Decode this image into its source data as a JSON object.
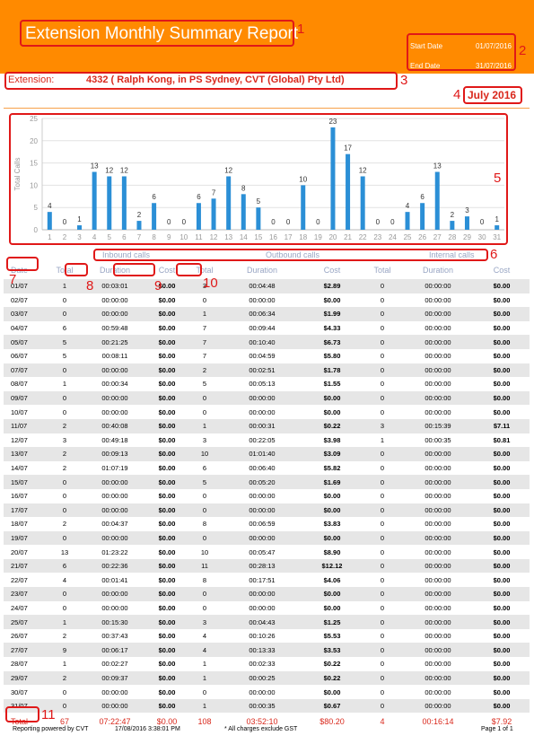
{
  "report": {
    "title": "Extension Monthly Summary Report",
    "start_date_label": "Start Date",
    "start_date": "01/07/2016",
    "end_date_label": "End Date",
    "end_date": "31/07/2016",
    "extension_label": "Extension:",
    "extension_value": "4332 ( Ralph Kong,  in PS Sydney,  CVT (Global) Pty Ltd)",
    "month": "July 2016"
  },
  "annotations": [
    "1",
    "2",
    "3",
    "4",
    "5",
    "6",
    "7",
    "8",
    "9",
    "10",
    "11"
  ],
  "legend": {
    "inbound": "Inbound calls",
    "outbound": "Outbound calls",
    "internal": "Internal calls"
  },
  "table": {
    "headers": [
      "Date",
      "Total",
      "Duration",
      "Cost",
      "Total",
      "Duration",
      "Cost",
      "Total",
      "Duration",
      "Cost"
    ],
    "rows": [
      [
        "01/07",
        "1",
        "00:03:01",
        "$0.00",
        "3",
        "00:04:48",
        "$2.89",
        "0",
        "00:00:00",
        "$0.00"
      ],
      [
        "02/07",
        "0",
        "00:00:00",
        "$0.00",
        "0",
        "00:00:00",
        "$0.00",
        "0",
        "00:00:00",
        "$0.00"
      ],
      [
        "03/07",
        "0",
        "00:00:00",
        "$0.00",
        "1",
        "00:06:34",
        "$1.99",
        "0",
        "00:00:00",
        "$0.00"
      ],
      [
        "04/07",
        "6",
        "00:59:48",
        "$0.00",
        "7",
        "00:09:44",
        "$4.33",
        "0",
        "00:00:00",
        "$0.00"
      ],
      [
        "05/07",
        "5",
        "00:21:25",
        "$0.00",
        "7",
        "00:10:40",
        "$6.73",
        "0",
        "00:00:00",
        "$0.00"
      ],
      [
        "06/07",
        "5",
        "00:08:11",
        "$0.00",
        "7",
        "00:04:59",
        "$5.80",
        "0",
        "00:00:00",
        "$0.00"
      ],
      [
        "07/07",
        "0",
        "00:00:00",
        "$0.00",
        "2",
        "00:02:51",
        "$1.78",
        "0",
        "00:00:00",
        "$0.00"
      ],
      [
        "08/07",
        "1",
        "00:00:34",
        "$0.00",
        "5",
        "00:05:13",
        "$1.55",
        "0",
        "00:00:00",
        "$0.00"
      ],
      [
        "09/07",
        "0",
        "00:00:00",
        "$0.00",
        "0",
        "00:00:00",
        "$0.00",
        "0",
        "00:00:00",
        "$0.00"
      ],
      [
        "10/07",
        "0",
        "00:00:00",
        "$0.00",
        "0",
        "00:00:00",
        "$0.00",
        "0",
        "00:00:00",
        "$0.00"
      ],
      [
        "11/07",
        "2",
        "00:40:08",
        "$0.00",
        "1",
        "00:00:31",
        "$0.22",
        "3",
        "00:15:39",
        "$7.11"
      ],
      [
        "12/07",
        "3",
        "00:49:18",
        "$0.00",
        "3",
        "00:22:05",
        "$3.98",
        "1",
        "00:00:35",
        "$0.81"
      ],
      [
        "13/07",
        "2",
        "00:09:13",
        "$0.00",
        "10",
        "01:01:40",
        "$3.09",
        "0",
        "00:00:00",
        "$0.00"
      ],
      [
        "14/07",
        "2",
        "01:07:19",
        "$0.00",
        "6",
        "00:06:40",
        "$5.82",
        "0",
        "00:00:00",
        "$0.00"
      ],
      [
        "15/07",
        "0",
        "00:00:00",
        "$0.00",
        "5",
        "00:05:20",
        "$1.69",
        "0",
        "00:00:00",
        "$0.00"
      ],
      [
        "16/07",
        "0",
        "00:00:00",
        "$0.00",
        "0",
        "00:00:00",
        "$0.00",
        "0",
        "00:00:00",
        "$0.00"
      ],
      [
        "17/07",
        "0",
        "00:00:00",
        "$0.00",
        "0",
        "00:00:00",
        "$0.00",
        "0",
        "00:00:00",
        "$0.00"
      ],
      [
        "18/07",
        "2",
        "00:04:37",
        "$0.00",
        "8",
        "00:06:59",
        "$3.83",
        "0",
        "00:00:00",
        "$0.00"
      ],
      [
        "19/07",
        "0",
        "00:00:00",
        "$0.00",
        "0",
        "00:00:00",
        "$0.00",
        "0",
        "00:00:00",
        "$0.00"
      ],
      [
        "20/07",
        "13",
        "01:23:22",
        "$0.00",
        "10",
        "00:05:47",
        "$8.90",
        "0",
        "00:00:00",
        "$0.00"
      ],
      [
        "21/07",
        "6",
        "00:22:36",
        "$0.00",
        "11",
        "00:28:13",
        "$12.12",
        "0",
        "00:00:00",
        "$0.00"
      ],
      [
        "22/07",
        "4",
        "00:01:41",
        "$0.00",
        "8",
        "00:17:51",
        "$4.06",
        "0",
        "00:00:00",
        "$0.00"
      ],
      [
        "23/07",
        "0",
        "00:00:00",
        "$0.00",
        "0",
        "00:00:00",
        "$0.00",
        "0",
        "00:00:00",
        "$0.00"
      ],
      [
        "24/07",
        "0",
        "00:00:00",
        "$0.00",
        "0",
        "00:00:00",
        "$0.00",
        "0",
        "00:00:00",
        "$0.00"
      ],
      [
        "25/07",
        "1",
        "00:15:30",
        "$0.00",
        "3",
        "00:04:43",
        "$1.25",
        "0",
        "00:00:00",
        "$0.00"
      ],
      [
        "26/07",
        "2",
        "00:37:43",
        "$0.00",
        "4",
        "00:10:26",
        "$5.53",
        "0",
        "00:00:00",
        "$0.00"
      ],
      [
        "27/07",
        "9",
        "00:06:17",
        "$0.00",
        "4",
        "00:13:33",
        "$3.53",
        "0",
        "00:00:00",
        "$0.00"
      ],
      [
        "28/07",
        "1",
        "00:02:27",
        "$0.00",
        "1",
        "00:02:33",
        "$0.22",
        "0",
        "00:00:00",
        "$0.00"
      ],
      [
        "29/07",
        "2",
        "00:09:37",
        "$0.00",
        "1",
        "00:00:25",
        "$0.22",
        "0",
        "00:00:00",
        "$0.00"
      ],
      [
        "30/07",
        "0",
        "00:00:00",
        "$0.00",
        "0",
        "00:00:00",
        "$0.00",
        "0",
        "00:00:00",
        "$0.00"
      ],
      [
        "31/07",
        "0",
        "00:00:00",
        "$0.00",
        "1",
        "00:00:35",
        "$0.67",
        "0",
        "00:00:00",
        "$0.00"
      ]
    ],
    "totals": [
      "Total",
      "67",
      "07:22:47",
      "$0.00",
      "108",
      "03:52:10",
      "$80.20",
      "4",
      "00:16:14",
      "$7.92"
    ]
  },
  "footer": {
    "powered_by": "Reporting powered by CVT",
    "generated": "17/08/2016 3:38:01 PM",
    "note": "* All charges exclude GST",
    "page": "Page 1 of 1"
  },
  "chart_data": {
    "type": "bar",
    "ylabel": "Total Calls",
    "ylim": [
      0,
      25
    ],
    "yticks": [
      0,
      5,
      10,
      15,
      20,
      25
    ],
    "categories": [
      "1",
      "2",
      "3",
      "4",
      "5",
      "6",
      "7",
      "8",
      "9",
      "10",
      "11",
      "12",
      "13",
      "14",
      "15",
      "16",
      "17",
      "18",
      "19",
      "20",
      "21",
      "22",
      "23",
      "24",
      "25",
      "26",
      "27",
      "28",
      "29",
      "30",
      "31"
    ],
    "values": [
      4,
      0,
      1,
      13,
      12,
      12,
      2,
      6,
      0,
      0,
      6,
      7,
      12,
      8,
      5,
      0,
      0,
      10,
      0,
      23,
      17,
      12,
      0,
      0,
      4,
      6,
      13,
      2,
      3,
      0,
      1
    ],
    "bar_color": "#2b8fd6",
    "grid": true
  }
}
